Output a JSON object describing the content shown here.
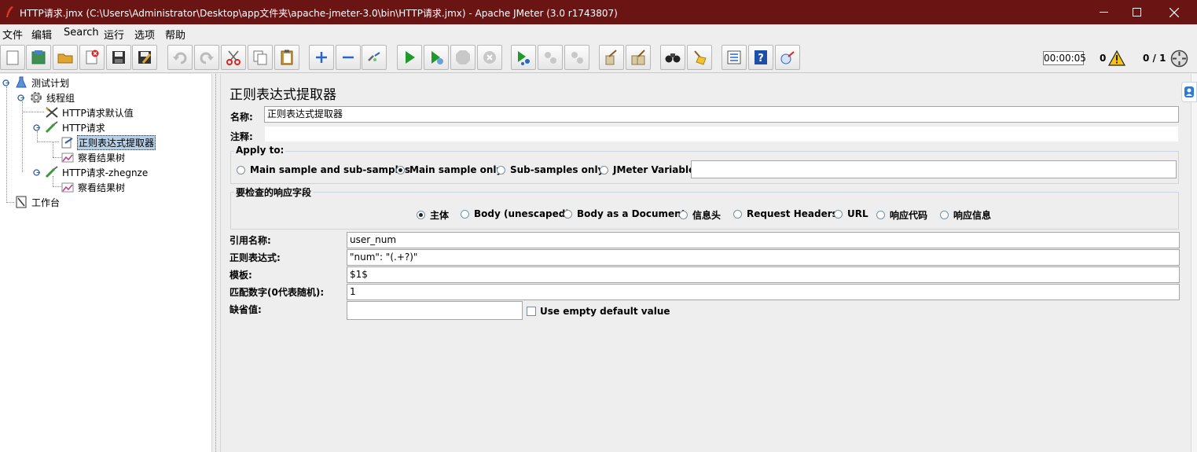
{
  "window": {
    "title": "HTTP请求.jmx (C:\\Users\\Administrator\\Desktop\\app文件夹\\apache-jmeter-3.0\\bin\\HTTP请求.jmx) - Apache JMeter (3.0 r1743807)",
    "controls": [
      "minimize-icon",
      "maximize-icon",
      "close-icon"
    ]
  },
  "menu": {
    "items": [
      "文件",
      "编辑",
      "Search",
      "运行",
      "选项",
      "帮助"
    ]
  },
  "toolbar": {
    "buttons": [
      "new-icon",
      "templates-icon",
      "open-icon",
      "close-file-icon",
      "save-icon",
      "save-as-icon",
      "undo-icon",
      "redo-icon",
      "cut-icon",
      "copy-icon",
      "paste-icon",
      "expand-icon",
      "collapse-icon",
      "toggle-icon",
      "start-icon",
      "start-no-pause-icon",
      "stop-icon",
      "shutdown-icon",
      "remote-start-icon",
      "remote-stop-icon",
      "remote-shutdown-icon",
      "clear-icon",
      "clear-all-icon",
      "search-icon",
      "reset-search-icon",
      "function-helper-icon",
      "help-icon",
      "log-viewer-icon"
    ],
    "timer": "00:00:05",
    "error_count": "0",
    "threads": "0 / 1"
  },
  "tree": {
    "nodes": [
      {
        "label": "测试计划",
        "icon": "test-plan-icon"
      },
      {
        "label": "线程组",
        "icon": "thread-group-icon"
      },
      {
        "label": "HTTP请求默认值",
        "icon": "config-element-icon"
      },
      {
        "label": "HTTP请求",
        "icon": "sampler-icon"
      },
      {
        "label": "正则表达式提取器",
        "icon": "post-processor-icon",
        "selected": true
      },
      {
        "label": "察看结果树",
        "icon": "listener-icon"
      },
      {
        "label": "HTTP请求-zhegnze",
        "icon": "sampler-icon"
      },
      {
        "label": "察看结果树",
        "icon": "listener-icon"
      },
      {
        "label": "工作台",
        "icon": "workbench-icon"
      }
    ]
  },
  "panel": {
    "heading": "正则表达式提取器",
    "name_label": "名称:",
    "name_value": "正则表达式提取器",
    "comment_label": "注释:",
    "comment_value": "",
    "apply_to": {
      "title": "Apply to:",
      "options": [
        "Main sample and sub-samples",
        "Main sample only",
        "Sub-samples only",
        "JMeter Variable"
      ],
      "selected": "Main sample only",
      "variable_value": ""
    },
    "field_to_check": {
      "title": "要检查的响应字段",
      "options": [
        "主体",
        "Body (unescaped)",
        "Body as a Document",
        "信息头",
        "Request Headers",
        "URL",
        "响应代码",
        "响应信息"
      ],
      "selected": "主体"
    },
    "reference_name": {
      "label": "引用名称:",
      "value": "user_num"
    },
    "regex": {
      "label": "正则表达式:",
      "value": "\"num\": \"(.+?)\""
    },
    "template": {
      "label": "模板:",
      "value": "$1$"
    },
    "match_no": {
      "label": "匹配数字(0代表随机):",
      "value": "1"
    },
    "default_value": {
      "label": "缺省值:",
      "value": ""
    },
    "use_empty_default": {
      "label": "Use empty default value",
      "checked": false
    }
  }
}
